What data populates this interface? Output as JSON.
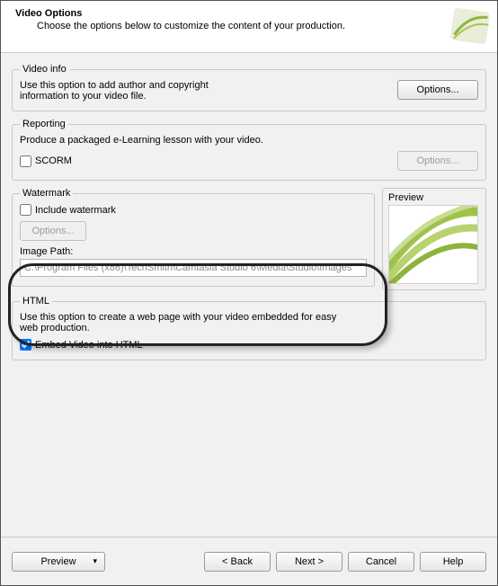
{
  "header": {
    "title": "Video Options",
    "subtitle": "Choose the options below to customize the content of your production."
  },
  "videoInfo": {
    "legend": "Video info",
    "text": "Use this option to add author and copyright information to your video file.",
    "optionsBtn": "Options..."
  },
  "reporting": {
    "legend": "Reporting",
    "text": "Produce a packaged  e-Learning lesson with your video.",
    "scormLabel": "SCORM",
    "scormChecked": false,
    "optionsBtn": "Options..."
  },
  "watermark": {
    "legend": "Watermark",
    "includeLabel": "Include watermark",
    "includeChecked": false,
    "optionsBtn": "Options...",
    "imagePathLabel": "Image Path:",
    "imagePath": "C:\\Program Files (x86)\\TechSmith\\Camtasia Studio 6\\Media\\Studio\\Images",
    "previewLabel": "Preview"
  },
  "html": {
    "legend": "HTML",
    "text": "Use this option to create a web page with your video embedded for easy web production.",
    "embedLabel": "Embed Video into HTML",
    "embedChecked": true
  },
  "footer": {
    "preview": "Preview",
    "back": "< Back",
    "next": "Next >",
    "cancel": "Cancel",
    "help": "Help"
  }
}
